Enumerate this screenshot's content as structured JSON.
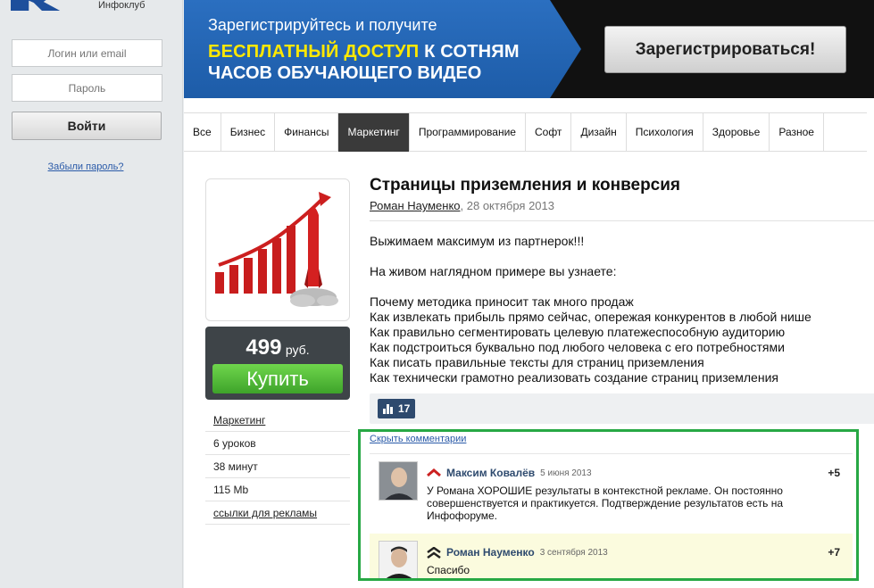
{
  "sidebar": {
    "logo_text": "Инфоклуб",
    "login_placeholder": "Логин или email",
    "password_placeholder": "Пароль",
    "login_button": "Войти",
    "forgot_link": "Забыли пароль?"
  },
  "banner": {
    "line1": "Зарегистрируйтесь и получите",
    "line2_highlight": "БЕСПЛАТНЫЙ ДОСТУП",
    "line2_rest": " К СОТНЯМ",
    "line3": "ЧАСОВ ОБУЧАЮЩЕГО ВИДЕО",
    "register_button": "Зарегистрироваться!"
  },
  "tabs": [
    {
      "label": "Все"
    },
    {
      "label": "Бизнес"
    },
    {
      "label": "Финансы"
    },
    {
      "label": "Маркетинг",
      "active": true
    },
    {
      "label": "Программирование"
    },
    {
      "label": "Софт"
    },
    {
      "label": "Дизайн"
    },
    {
      "label": "Психология"
    },
    {
      "label": "Здоровье"
    },
    {
      "label": "Разное"
    }
  ],
  "product": {
    "price_value": "499",
    "price_currency": "руб.",
    "buy_button": "Купить",
    "meta": [
      {
        "text": "Маркетинг",
        "link": true
      },
      {
        "text": "6 уроков",
        "link": false
      },
      {
        "text": "38 минут",
        "link": false
      },
      {
        "text": "115 Mb",
        "link": false
      },
      {
        "text": "ссылки для рекламы",
        "link": true
      }
    ]
  },
  "article": {
    "title": "Страницы приземления и конверсия",
    "author": "Роман Науменко",
    "date": ", 28 октября 2013",
    "intro": "Выжимаем максимум из партнерок!!!",
    "lead": "На живом наглядном примере вы узнаете:",
    "points": [
      "Почему методика приносит так много продаж",
      "Как извлекать прибыль прямо сейчас, опережая конкурентов в любой нише",
      "Как правильно сегментировать целевую платежеспособную аудиторию",
      "Как подстроиться буквально под любого человека с его потребностями",
      "Как писать правильные тексты для страниц приземления",
      "Как технически грамотно реализовать создание страниц приземления"
    ],
    "views": "17"
  },
  "comments": {
    "hide_link": "Скрыть комментарии",
    "items": [
      {
        "author": "Максим Ковалёв",
        "date": "5 июня 2013",
        "score": "+5",
        "text": "У Романа ХОРОШИЕ результаты в контекстной рекламе. Он постоянно совершенствуется и практикуется. Подтверждение результатов есть на Инфофоруме.",
        "rank_color": "#cc2222"
      },
      {
        "author": "Роман Науменко",
        "date": "3 сентября 2013",
        "score": "+7",
        "text": "Спасибо",
        "rank_color": "#222222"
      }
    ]
  },
  "colors": {
    "accent_blue": "#2b6fc0",
    "banner_highlight": "#ffe800",
    "buy_green": "#3ea32a",
    "frame_green": "#27a844",
    "link_blue": "#2a5aa8"
  }
}
